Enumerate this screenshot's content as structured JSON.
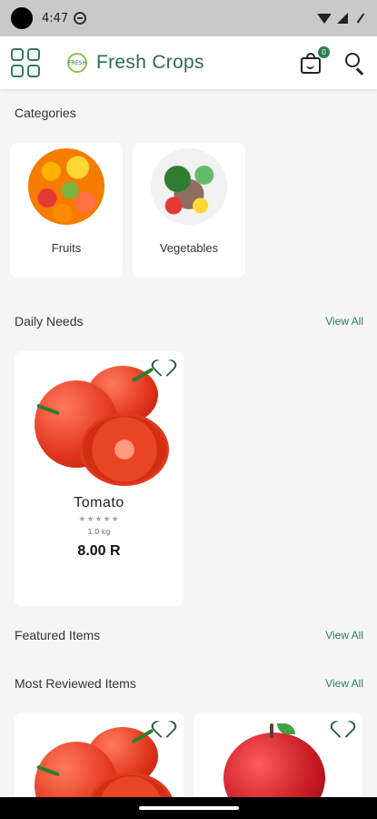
{
  "status_bar": {
    "time": "4:47"
  },
  "app_bar": {
    "brand": "Fresh Crops",
    "logo_text": "FRESH",
    "cart_count": "0",
    "icons": [
      "grid-menu-icon",
      "leaf-logo-icon",
      "cart-icon",
      "search-icon"
    ]
  },
  "categories": {
    "title": "Categories",
    "items": [
      {
        "label": "Fruits"
      },
      {
        "label": "Vegetables"
      }
    ]
  },
  "daily_needs": {
    "title": "Daily Needs",
    "view_all": "View All",
    "products": [
      {
        "name": "Tomato",
        "stars": "★★★★★",
        "weight": "1.0 kg",
        "price": "8.00 R"
      }
    ]
  },
  "featured": {
    "title": "Featured Items",
    "view_all": "View All"
  },
  "most_reviewed": {
    "title": "Most Reviewed Items",
    "view_all": "View All"
  },
  "colors": {
    "brand_green": "#2f7d55",
    "background": "#f5f5f5"
  }
}
